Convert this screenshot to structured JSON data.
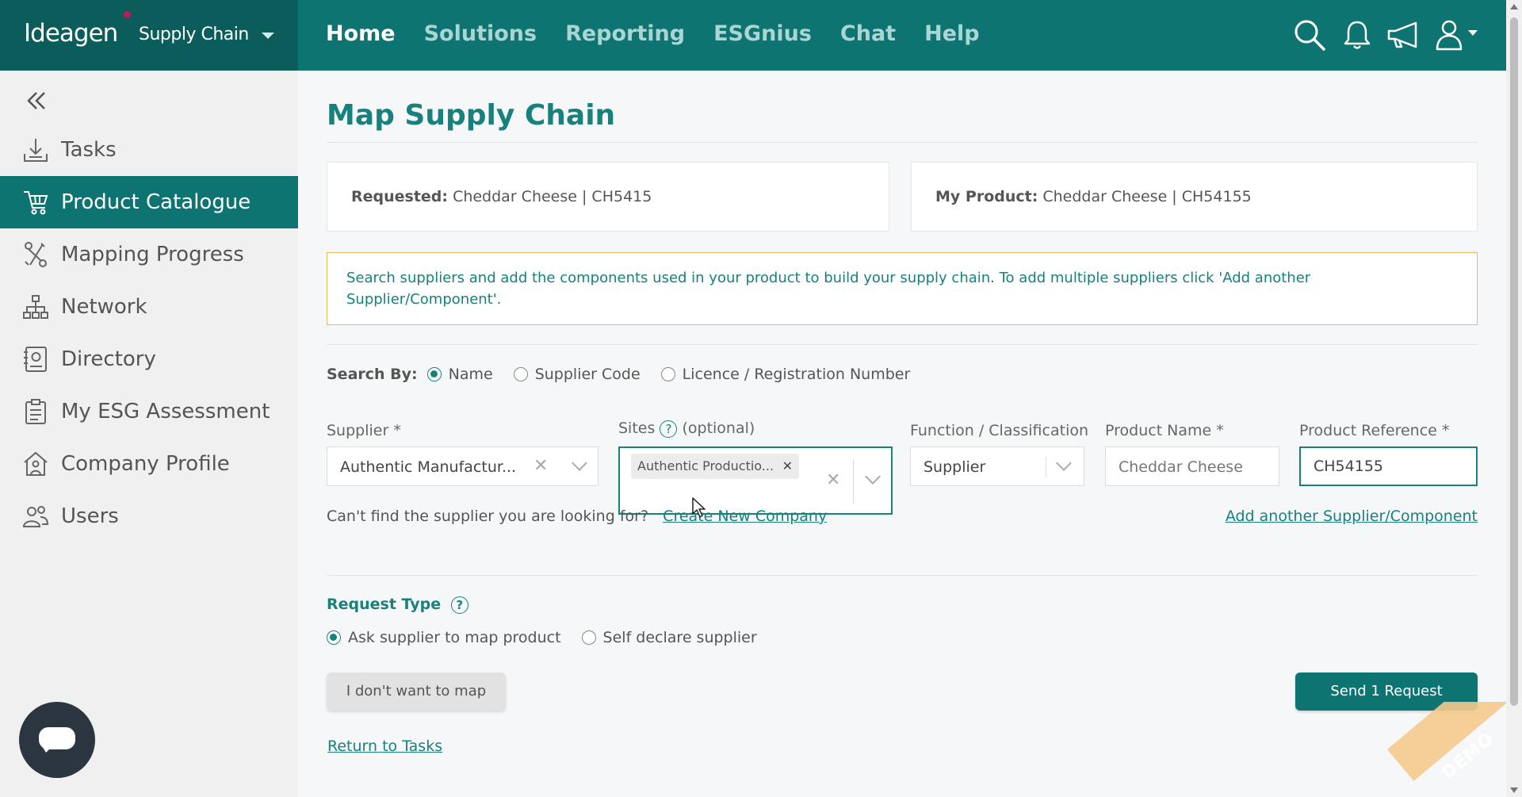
{
  "brand": {
    "logo": "Ideagen",
    "product": "Supply Chain"
  },
  "nav": {
    "items": [
      {
        "label": "Home",
        "active": true
      },
      {
        "label": "Solutions",
        "active": false
      },
      {
        "label": "Reporting",
        "active": false
      },
      {
        "label": "ESGnius",
        "active": false
      },
      {
        "label": "Chat",
        "active": false
      },
      {
        "label": "Help",
        "active": false
      }
    ],
    "icons": [
      "search-icon",
      "bell-icon",
      "megaphone-icon",
      "user-icon"
    ]
  },
  "sidebar": {
    "items": [
      {
        "label": "Tasks",
        "icon": "download-tray-icon",
        "active": false
      },
      {
        "label": "Product Catalogue",
        "icon": "cart-icon",
        "active": true
      },
      {
        "label": "Mapping Progress",
        "icon": "route-icon",
        "active": false
      },
      {
        "label": "Network",
        "icon": "network-icon",
        "active": false
      },
      {
        "label": "Directory",
        "icon": "directory-icon",
        "active": false
      },
      {
        "label": "My ESG Assessment",
        "icon": "clipboard-icon",
        "active": false
      },
      {
        "label": "Company Profile",
        "icon": "building-icon",
        "active": false
      },
      {
        "label": "Users",
        "icon": "users-icon",
        "active": false
      }
    ]
  },
  "page": {
    "title": "Map Supply Chain",
    "requested_label": "Requested:",
    "requested_value": "Cheddar Cheese | CH5415",
    "my_product_label": "My Product:",
    "my_product_value": "Cheddar Cheese | CH54155",
    "notice": "Search suppliers and add the components used in your product to build your supply chain. To add multiple suppliers click 'Add another Supplier/Component'."
  },
  "search_by": {
    "label": "Search By:",
    "options": [
      {
        "label": "Name",
        "selected": true
      },
      {
        "label": "Supplier Code",
        "selected": false
      },
      {
        "label": "Licence / Registration Number",
        "selected": false
      }
    ]
  },
  "form": {
    "supplier_label": "Supplier *",
    "supplier_value": "Authentic Manufactur...",
    "sites_label": "Sites",
    "sites_optional": "(optional)",
    "sites_tag": "Authentic Productio...",
    "function_label": "Function / Classification",
    "function_value": "Supplier",
    "product_name_label": "Product Name *",
    "product_name_value": "Cheddar Cheese",
    "product_ref_label": "Product Reference *",
    "product_ref_value": "CH54155"
  },
  "links": {
    "cant_find": "Can't find the supplier you are looking for?",
    "create_company": "Create New Company",
    "add_another": "Add another Supplier/Component",
    "return_tasks": "Return to Tasks"
  },
  "request_type": {
    "label": "Request Type",
    "options": [
      {
        "label": "Ask supplier to map product",
        "selected": true
      },
      {
        "label": "Self declare supplier",
        "selected": false
      }
    ]
  },
  "buttons": {
    "dont_map": "I don't want to map",
    "send": "Send 1 Request"
  },
  "badge": {
    "demo": "DEMO"
  },
  "colors": {
    "primary": "#0e7472",
    "brand_dark": "#0a5d5b",
    "notice_border": "#f0b85b",
    "link": "#17817e"
  }
}
